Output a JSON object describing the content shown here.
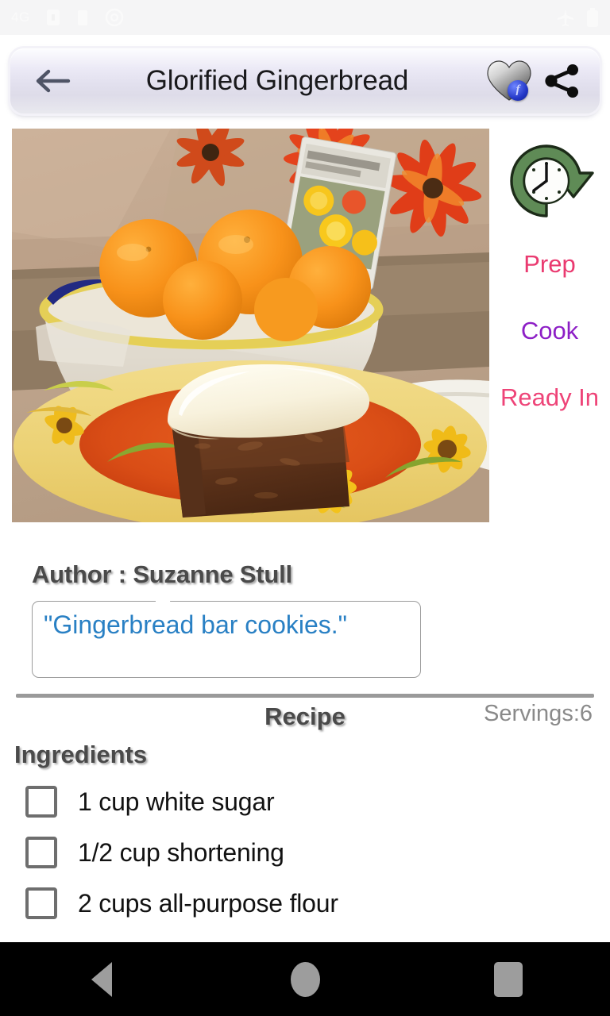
{
  "statusbar": {
    "signal_text": "4G",
    "icons": [
      "signal-icon",
      "sim-icon",
      "battery-small-icon",
      "at-icon"
    ],
    "right_icons": [
      "airplane-mode-icon",
      "battery-icon"
    ]
  },
  "appbar": {
    "back_icon": "back-arrow-icon",
    "title": "Glorified Gingerbread",
    "favorite_icon": "heart-icon",
    "favorite_badge": "f",
    "share_icon": "share-icon"
  },
  "hero": {
    "alt": "gingerbread-slice-with-whipped-cream-photo"
  },
  "times": {
    "clock_icon": "clock-history-icon",
    "prep_label": "Prep",
    "cook_label": "Cook",
    "ready_label": "Ready In",
    "prep_color": "#ea3a70",
    "cook_color": "#8d1fc6",
    "ready_color": "#ee4478"
  },
  "author": {
    "line": "Author : Suzanne Stull",
    "quote": "\"Gingerbread bar cookies.\"",
    "quote_color": "#2980c4"
  },
  "recipe": {
    "title": "Recipe",
    "servings": "Servings:6",
    "ingredients_heading": "Ingredients",
    "ingredients": [
      "1 cup white sugar",
      "1/2 cup shortening",
      "2 cups all-purpose flour"
    ]
  },
  "navbar": {
    "back": "nav-back-icon",
    "home": "nav-home-icon",
    "recents": "nav-recents-icon"
  }
}
